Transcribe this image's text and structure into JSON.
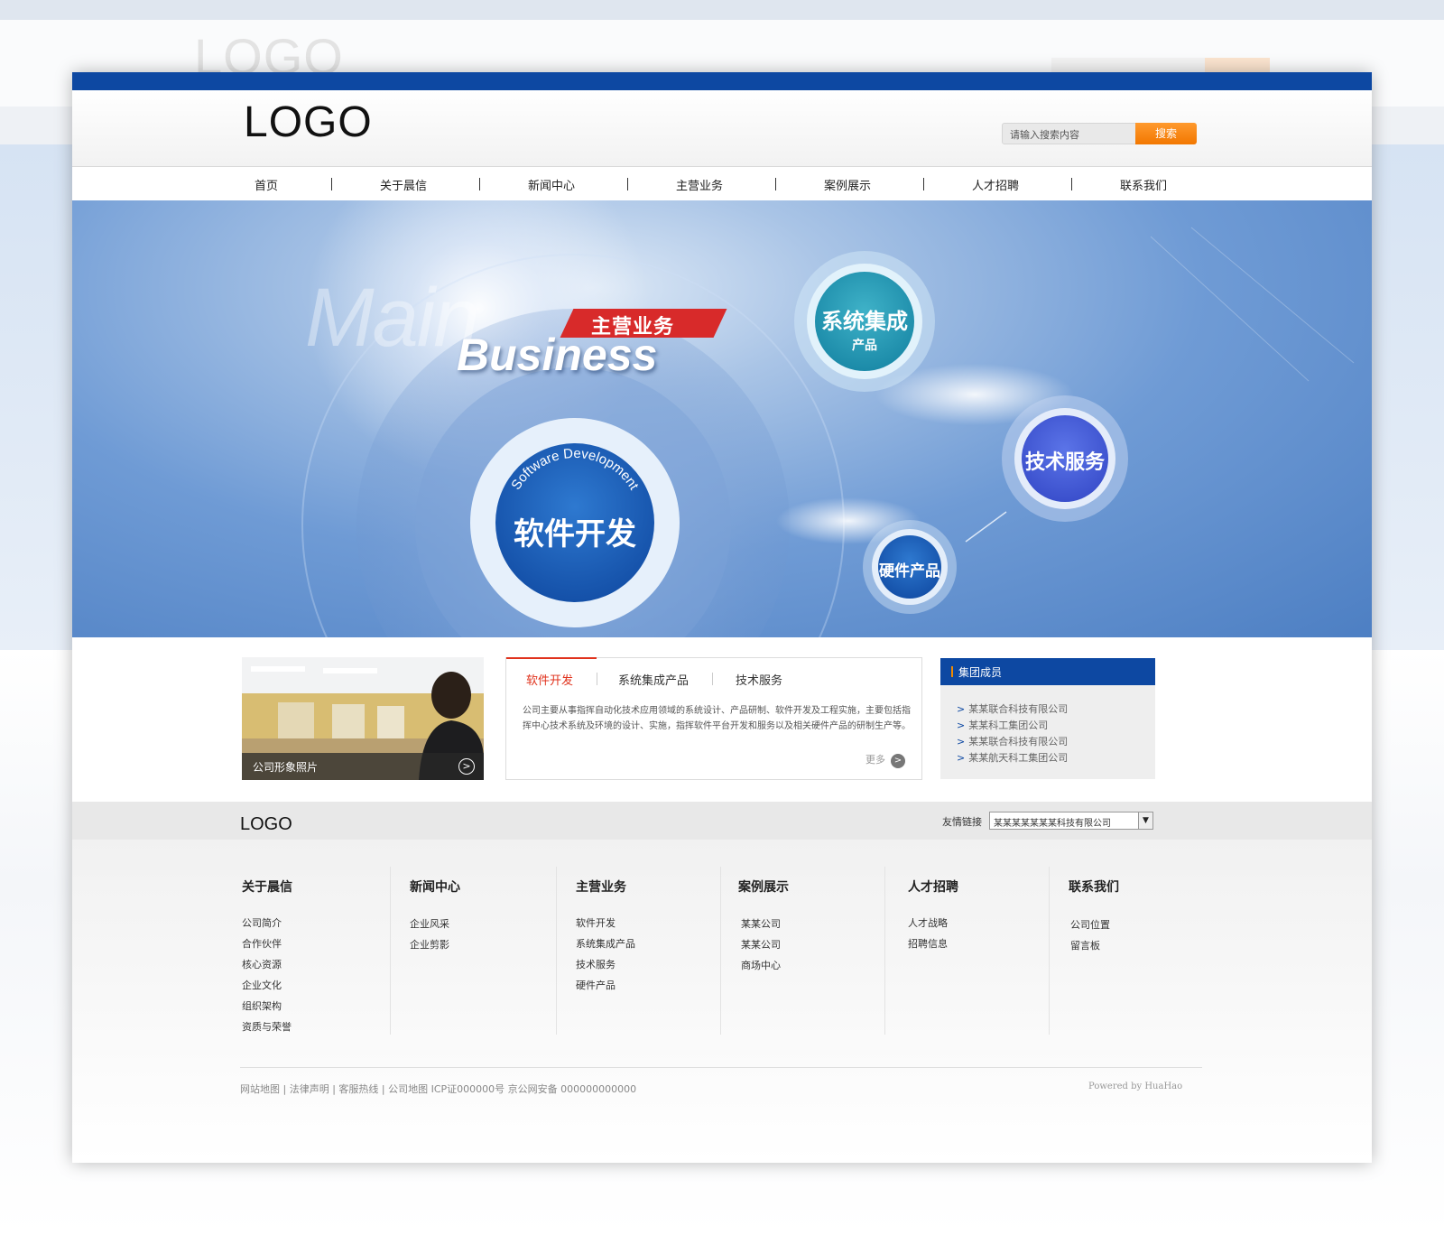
{
  "backdrop": {
    "ghost_logo": "LOGO"
  },
  "header": {
    "logo": "LOGO",
    "search_placeholder": "请输入搜索内容",
    "search_button": "搜索"
  },
  "nav": {
    "items": [
      "首页",
      "关于晨信",
      "新闻中心",
      "主营业务",
      "案例展示",
      "人才招聘",
      "联系我们"
    ]
  },
  "banner": {
    "main_word": "Main",
    "tag": "主营业务",
    "business_word": "Business",
    "circles": {
      "software": {
        "arc_text": "Software Development",
        "label": "软件开发"
      },
      "system": {
        "label": "系统集成",
        "sub": "产品"
      },
      "tech": {
        "label": "技术服务"
      },
      "hardware": {
        "label": "硬件产品"
      }
    }
  },
  "photo_card": {
    "caption": "公司形象照片"
  },
  "tabs_card": {
    "tabs": [
      "软件开发",
      "系统集成产品",
      "技术服务"
    ],
    "body": "公司主要从事指挥自动化技术应用领域的系统设计、产品研制、软件开发及工程实施，主要包括指挥中心技术系统及环境的设计、实施，指挥软件平台开发和服务以及相关硬件产品的研制生产等。",
    "more": "更多"
  },
  "group_card": {
    "title": "集团成员",
    "items": [
      "某某联合科技有限公司",
      "某某科工集团公司",
      "某某联合科技有限公司",
      "某某航天科工集团公司"
    ]
  },
  "footer": {
    "logo": "LOGO",
    "friend_label": "友情链接",
    "friend_selected": "某某某某某某某科技有限公司",
    "columns": [
      {
        "title": "关于晨信",
        "links": [
          "公司简介",
          "合作伙伴",
          "核心资源",
          "企业文化",
          "组织架构",
          "资质与荣誉"
        ]
      },
      {
        "title": "新闻中心",
        "links": [
          "企业风采",
          "企业剪影"
        ]
      },
      {
        "title": "主营业务",
        "links": [
          "软件开发",
          "系统集成产品",
          "技术服务",
          "硬件产品"
        ]
      },
      {
        "title": "案例展示",
        "links": [
          "某某公司",
          "某某公司",
          "商场中心"
        ]
      },
      {
        "title": "人才招聘",
        "links": [
          "人才战略",
          "招聘信息"
        ]
      },
      {
        "title": "联系我们",
        "links": [
          "公司位置",
          "留言板"
        ]
      }
    ],
    "bottom_links": "网站地图 | 法律声明 | 客服热线 | 公司地图    ICP证000000号 京公网安备 000000000000",
    "powered": "Powered by HuaHao"
  }
}
